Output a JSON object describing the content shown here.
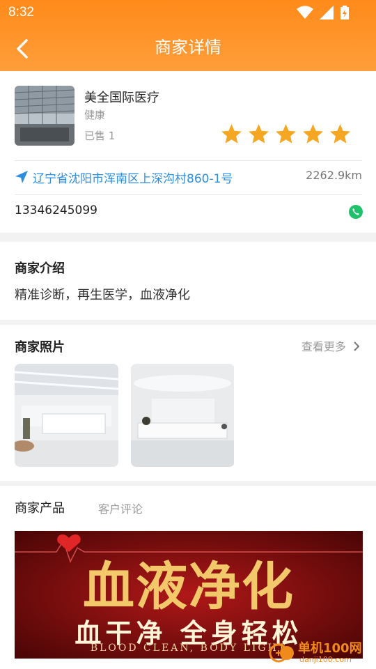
{
  "status_bar": {
    "time": "8:32"
  },
  "header": {
    "title": "商家详情"
  },
  "merchant": {
    "name": "美全国际医疗",
    "category": "健康",
    "sold": "已售 1",
    "rating": 5,
    "address": "辽宁省沈阳市浑南区上深沟村860-1号",
    "distance": "2262.9km",
    "phone": "13346245099"
  },
  "intro": {
    "title": "商家介绍",
    "text": "精准诊断，再生医学，血液净化"
  },
  "photos": {
    "title": "商家照片",
    "more_label": "查看更多"
  },
  "products": {
    "tabs": [
      "商家产品",
      "客户评论"
    ],
    "banner": {
      "headline": "血液净化",
      "subline": "血干净  全身轻松",
      "english": "BLOOD CLEAN, BODY LIGHT"
    }
  },
  "watermark": {
    "brand": "单机100网",
    "url": "danji100.com"
  },
  "colors": {
    "accent": "#ff8a1a",
    "link": "#2d8ee0",
    "star": "#f5a623",
    "phone": "#1fc26b"
  }
}
